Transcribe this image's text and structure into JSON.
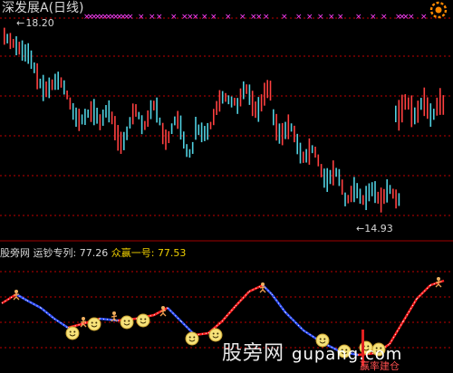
{
  "header": {
    "title": "深发展A(日线)",
    "marker_symbol": "×"
  },
  "price_chart": {
    "high_label": "18.20",
    "low_label": "14.93",
    "colors": {
      "up": "#ff4040",
      "down": "#50d0e0",
      "marker": "#ff40ff",
      "dash": "#c00000"
    }
  },
  "indicator": {
    "prefix": "股旁网",
    "name1": "运钞专列:",
    "value1": "77.26",
    "name2": "众赢一号:",
    "value2": "77.53"
  },
  "watermark": {
    "text": "股旁网",
    "domain": "gupang.com"
  },
  "bottom_text": "赢率建仓"
}
